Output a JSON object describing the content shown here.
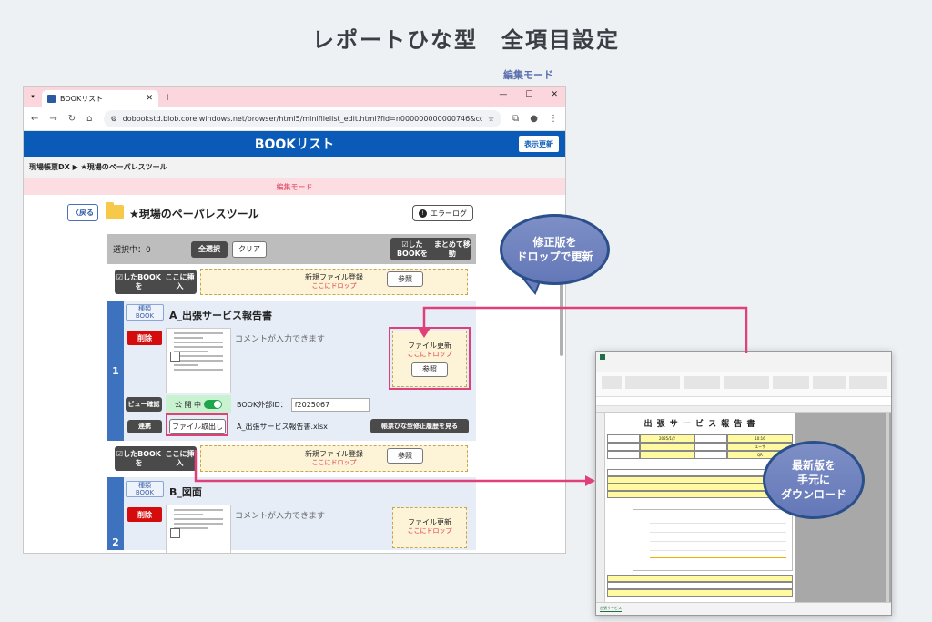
{
  "heading": "レポートひな型　全項目設定",
  "mode_caption": "編集モード",
  "browser": {
    "tab_title": "BOOKリスト",
    "url": "dobookstd.blob.core.windows.net/browser/html5/minifilelist_edit.html?fid=n000000000000746&conna...",
    "app_title": "BOOKリスト",
    "refresh_button": "表示更新",
    "breadcrumb": "現場帳票DX ▶ ★現場のペーパレスツール",
    "edit_mode_band": "編集モード",
    "back_button": "戻る",
    "folder_title": "★現場のペーパレスツール",
    "error_log_button": "エラーログ",
    "selected_text": "選択中：0",
    "select_all_button": "全選択",
    "clear_button": "クリア",
    "move_button": [
      "☑したBOOKを",
      "まとめて移動"
    ],
    "insert_button": [
      "☑したBOOKを",
      "ここに挿入"
    ],
    "new_file_label": "新規ファイル登録",
    "drop_here": "ここにドロップ",
    "browse_button": "参照",
    "books": [
      {
        "number": "1",
        "badge": [
          "種類",
          "BOOK"
        ],
        "title": "A_出張サービス報告書",
        "delete_button": "削除",
        "comment_placeholder": "コメントが入力できます",
        "update_label": "ファイル更新",
        "view_check_button": "ビュー確認",
        "public_label": "公 開 中",
        "external_id_label": "BOOK外部ID：",
        "external_id_value": "f2025067",
        "link_button": "連携",
        "take_out_button": "ファイル取出し",
        "file_name": "A_出張サービス報告書.xlsx",
        "history_button": "帳票ひな型修正履歴を見る"
      },
      {
        "number": "2",
        "badge": [
          "種類",
          "BOOK"
        ],
        "title": "B_図面",
        "delete_button": "削除",
        "comment_placeholder": "コメントが入力できます",
        "update_label": "ファイル更新"
      }
    ]
  },
  "excel": {
    "doc_title": "出 張 サ ー ビ ス 報 告 書",
    "date_value": "2025/1/2",
    "time_value": "10:16",
    "user_value": "ユーザ",
    "qr_value": "QR",
    "sheet_tab": "出張サービス"
  },
  "bubbles": {
    "update": [
      "修正版を",
      "ドロップで更新"
    ],
    "download": [
      "最新版を",
      "手元に",
      "ダウンロード"
    ]
  },
  "colors": {
    "header_blue": "#0a5ab8",
    "highlight_pink": "#e0407a",
    "bubble": "#7182c0"
  }
}
